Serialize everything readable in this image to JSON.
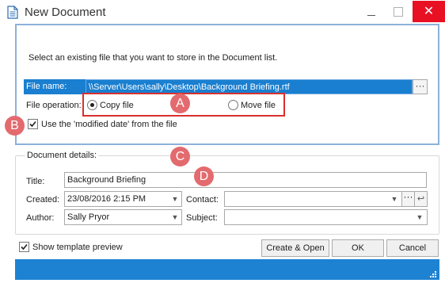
{
  "window": {
    "title": "New Document",
    "icons": {
      "app": "document-icon",
      "minimize": "minimize-icon",
      "maximize": "maximize-icon",
      "close": "close-icon"
    },
    "close_symbol": "✕"
  },
  "instruction": "Select an existing file that you want to store in the Document list.",
  "file_name": {
    "label": "File name:",
    "value": "\\\\Server\\Users\\sally\\Desktop\\Background Briefing.rtf",
    "browse_label": "···"
  },
  "file_operation": {
    "label": "File operation:",
    "options": [
      {
        "label": "Copy file",
        "selected": true
      },
      {
        "label": "Move file",
        "selected": false
      }
    ]
  },
  "use_modified_date": {
    "label": "Use the 'modified date' from the file",
    "checked": true
  },
  "markers": [
    "A",
    "B",
    "C",
    "D"
  ],
  "document_details": {
    "legend": "Document details:",
    "title": {
      "label": "Title:",
      "value": "Background Briefing"
    },
    "created": {
      "label": "Created:",
      "value": "23/08/2016 2:15 PM"
    },
    "contact": {
      "label": "Contact:",
      "value": "",
      "dots": "···",
      "link": "↩"
    },
    "author": {
      "label": "Author:",
      "value": "Sally Pryor"
    },
    "subject": {
      "label": "Subject:",
      "value": ""
    }
  },
  "show_template_preview": {
    "label": "Show template preview",
    "checked": true
  },
  "buttons": {
    "create_open": "Create & Open",
    "ok": "OK",
    "cancel": "Cancel"
  },
  "colors": {
    "accent_blue": "#1e82d2",
    "selection_blue": "#1a7fd0",
    "highlight_red": "#d9302c",
    "marker_red": "#e36a6e",
    "close_red": "#e81123"
  }
}
